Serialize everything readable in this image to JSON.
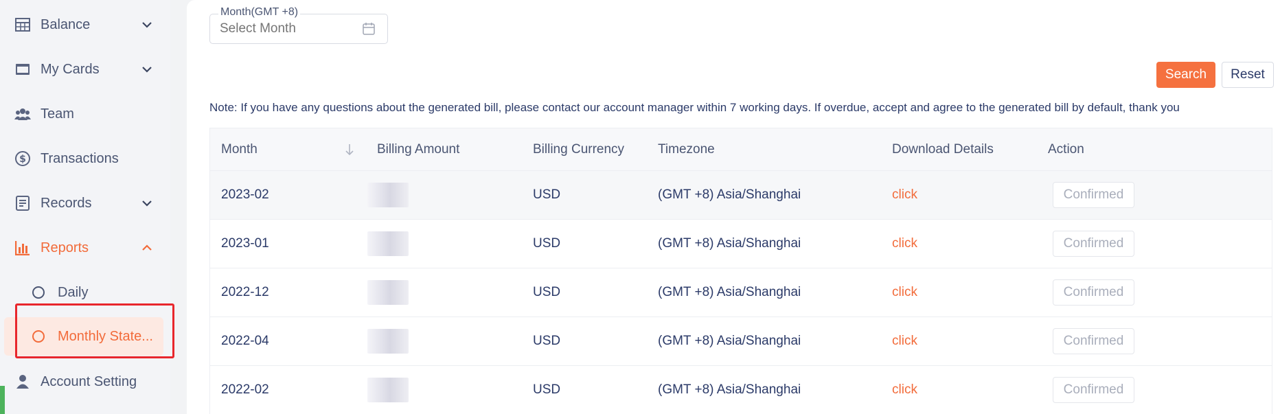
{
  "sidebar": {
    "items": [
      {
        "label": "Balance",
        "icon": "table-icon",
        "chevron": "down"
      },
      {
        "label": "My Cards",
        "icon": "card-icon",
        "chevron": "down"
      },
      {
        "label": "Team",
        "icon": "team-icon"
      },
      {
        "label": "Transactions",
        "icon": "dollar-exchange-icon"
      },
      {
        "label": "Records",
        "icon": "records-icon",
        "chevron": "down"
      },
      {
        "label": "Reports",
        "icon": "bar-chart-icon",
        "chevron": "up",
        "active": true
      },
      {
        "label": "Account Setting",
        "icon": "user-icon"
      }
    ],
    "reports_sub": [
      {
        "label": "Daily"
      },
      {
        "label": "Monthly State...",
        "active": true
      }
    ]
  },
  "filter": {
    "month_legend": "Month(GMT +8)",
    "month_placeholder": "Select Month"
  },
  "buttons": {
    "search": "Search",
    "reset": "Reset"
  },
  "note": "Note: If you have any questions about the generated bill, please contact our account manager within 7 working days. If overdue, accept and agree to the generated bill by default, thank you",
  "table": {
    "columns": [
      "Month",
      "Billing Amount",
      "Billing Currency",
      "Timezone",
      "Download Details",
      "Action"
    ],
    "rows": [
      {
        "month": "2023-02",
        "currency": "USD",
        "timezone": "(GMT +8) Asia/Shanghai",
        "download": "click",
        "action": "Confirmed"
      },
      {
        "month": "2023-01",
        "currency": "USD",
        "timezone": "(GMT +8) Asia/Shanghai",
        "download": "click",
        "action": "Confirmed"
      },
      {
        "month": "2022-12",
        "currency": "USD",
        "timezone": "(GMT +8) Asia/Shanghai",
        "download": "click",
        "action": "Confirmed"
      },
      {
        "month": "2022-04",
        "currency": "USD",
        "timezone": "(GMT +8) Asia/Shanghai",
        "download": "click",
        "action": "Confirmed"
      },
      {
        "month": "2022-02",
        "currency": "USD",
        "timezone": "(GMT +8) Asia/Shanghai",
        "download": "click",
        "action": "Confirmed"
      }
    ]
  },
  "colors": {
    "accent": "#f26b3a",
    "text": "#2b3a68",
    "highlight_box": "#e8262c"
  }
}
